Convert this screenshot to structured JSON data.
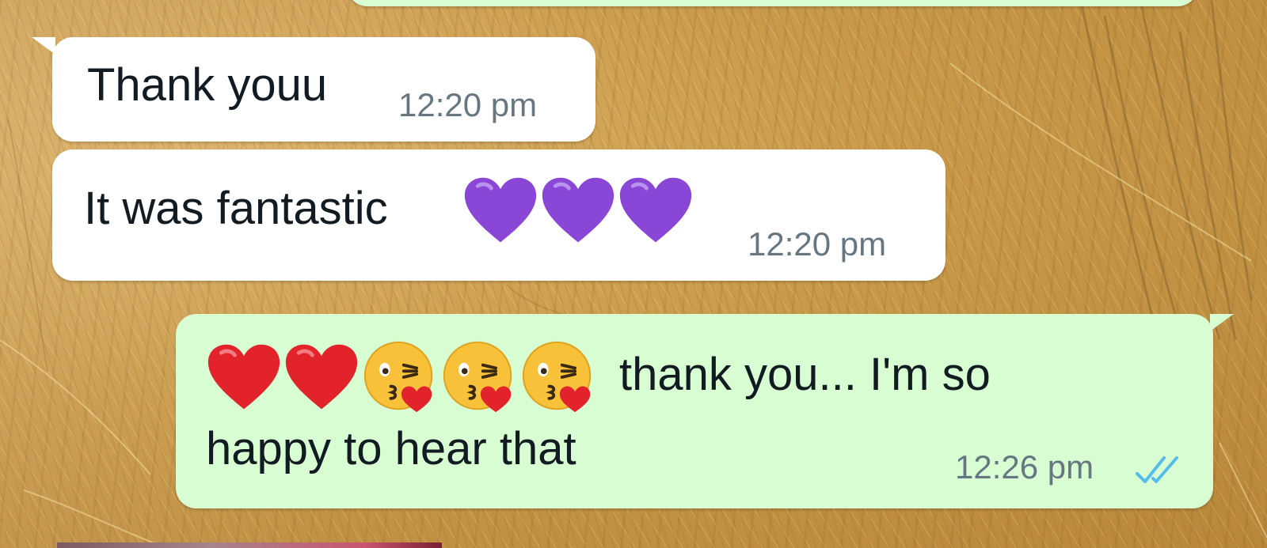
{
  "chat": {
    "messages": [
      {
        "direction": "incoming",
        "text": "Thank youu",
        "time": "12:20 pm"
      },
      {
        "direction": "incoming",
        "text": "It was fantastic",
        "emojis": [
          "purple-heart",
          "purple-heart",
          "purple-heart"
        ],
        "time": "12:20 pm"
      },
      {
        "direction": "outgoing",
        "emojis": [
          "red-heart",
          "red-heart",
          "kissing-face",
          "kissing-face",
          "kissing-face"
        ],
        "text_line1": "thank you... I'm so",
        "text_line2": "happy to hear that",
        "time": "12:26 pm",
        "status": "read"
      }
    ]
  },
  "colors": {
    "incoming_bubble": "#ffffff",
    "outgoing_bubble": "#d9fdd3",
    "text": "#111b21",
    "timestamp": "#667781",
    "read_ticks": "#53bdeb",
    "purple_heart": "#8a46d6",
    "red_heart": "#e3232c",
    "emoji_face": "#f7c13a"
  }
}
